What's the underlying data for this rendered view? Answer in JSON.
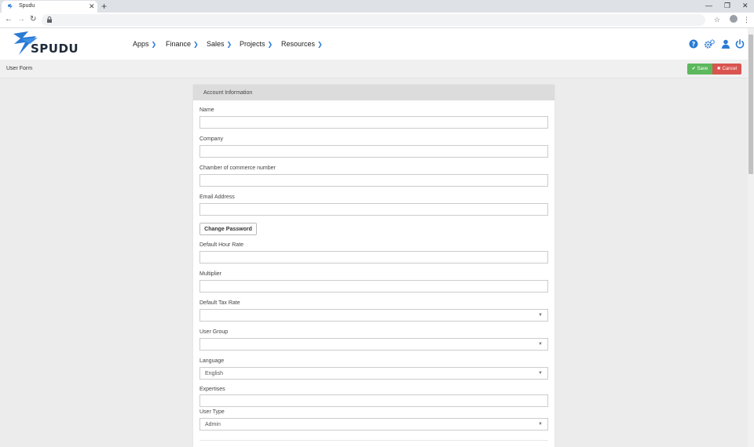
{
  "browser": {
    "tab_title": "Spudu",
    "icons": {
      "back": "arrow-left-icon",
      "forward": "arrow-right-icon",
      "reload": "reload-icon",
      "lock": "lock-icon",
      "bookmark": "star-icon",
      "profile": "account-circle-icon",
      "menu": "kebab-menu-icon"
    }
  },
  "app": {
    "logo_text": "SPUDU",
    "nav": [
      {
        "label": "Apps"
      },
      {
        "label": "Finance"
      },
      {
        "label": "Sales"
      },
      {
        "label": "Projects"
      },
      {
        "label": "Resources"
      }
    ],
    "header_icons": [
      "help-icon",
      "settings-gears-icon",
      "user-icon",
      "power-icon"
    ],
    "accent_color": "#2a7bd4"
  },
  "page": {
    "title": "User Form",
    "save_label": "Save",
    "cancel_label": "Cancel",
    "save_color": "#5cb85c",
    "cancel_color": "#d9534f"
  },
  "form": {
    "section_title": "Account Information",
    "fields": {
      "name": {
        "label": "Name",
        "value": ""
      },
      "company": {
        "label": "Company",
        "value": ""
      },
      "coc": {
        "label": "Chamber of commerce number",
        "value": ""
      },
      "email": {
        "label": "Email Address",
        "value": ""
      },
      "hour_rate": {
        "label": "Default Hour Rate",
        "value": ""
      },
      "multiplier": {
        "label": "Multiplier",
        "value": ""
      },
      "tax_rate": {
        "label": "Default Tax Rate",
        "value": ""
      },
      "user_group": {
        "label": "User Group",
        "value": ""
      },
      "language": {
        "label": "Language",
        "value": "English"
      },
      "expertises": {
        "label": "Expertises",
        "value": ""
      },
      "user_type": {
        "label": "User Type",
        "value": "Admin"
      }
    },
    "change_password_label": "Change Password"
  }
}
